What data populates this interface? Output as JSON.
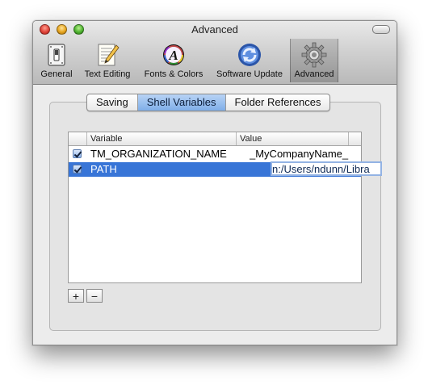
{
  "window": {
    "title": "Advanced"
  },
  "toolbar": {
    "items": [
      {
        "label": "General",
        "icon": "general-switch-icon"
      },
      {
        "label": "Text Editing",
        "icon": "text-editing-icon"
      },
      {
        "label": "Fonts & Colors",
        "icon": "fonts-colors-icon"
      },
      {
        "label": "Software Update",
        "icon": "software-update-icon"
      },
      {
        "label": "Advanced",
        "icon": "gear-icon",
        "selected": true
      }
    ]
  },
  "tabs": [
    {
      "label": "Saving"
    },
    {
      "label": "Shell Variables",
      "active": true
    },
    {
      "label": "Folder References"
    }
  ],
  "table": {
    "columns": [
      "Variable",
      "Value"
    ],
    "rows": [
      {
        "enabled": true,
        "variable": "TM_ORGANIZATION_NAME",
        "value": "_MyCompanyName_"
      },
      {
        "enabled": true,
        "variable": "PATH",
        "value": "n:/Users/ndunn/Libra",
        "selected": true,
        "editing": true
      }
    ]
  },
  "buttons": {
    "add": "+",
    "remove": "−"
  },
  "colors": {
    "selection": "#3875d7",
    "active_tab": "#7faee8"
  }
}
